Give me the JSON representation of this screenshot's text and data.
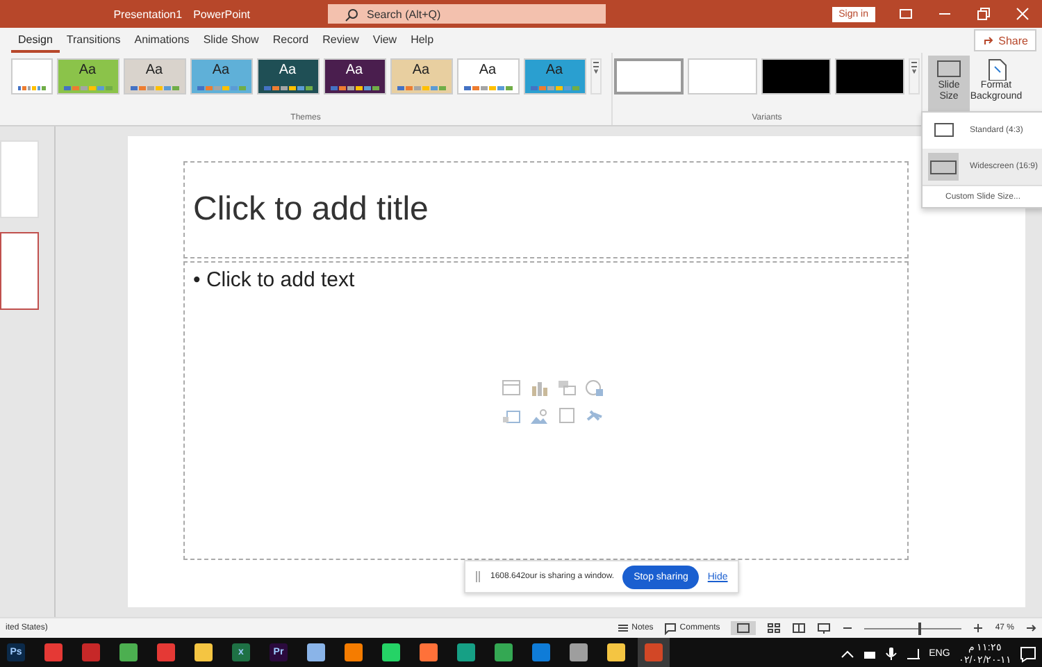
{
  "title_bar": {
    "file_name": "Presentation1",
    "app_name": "PowerPoint",
    "search": {
      "placeholder": "Search (Alt+Q)"
    },
    "sign_in": "Sign in"
  },
  "tabs": [
    {
      "label": "Design",
      "selected": true
    },
    {
      "label": "Transitions",
      "selected": false
    },
    {
      "label": "Animations",
      "selected": false
    },
    {
      "label": "Slide Show",
      "selected": false
    },
    {
      "label": "Record",
      "selected": false
    },
    {
      "label": "Review",
      "selected": false
    },
    {
      "label": "View",
      "selected": false
    },
    {
      "label": "Help",
      "selected": false
    }
  ],
  "share": "Share",
  "themes": {
    "label": "Themes",
    "items": [
      {
        "color": "#ffffff",
        "selected": false
      },
      {
        "label": "Aa",
        "color": "#8bc34a",
        "selected": false
      },
      {
        "label": "Aa",
        "color": "#d9d3cc",
        "selected": false
      },
      {
        "label": "Aa",
        "color": "#5fb0d8",
        "selected": false
      },
      {
        "label": "Aa",
        "color": "#1f4f55",
        "selected": false
      },
      {
        "label": "Aa",
        "color": "#4a1e4e",
        "selected": false
      },
      {
        "label": "Aa",
        "color": "#e8cfa0",
        "selected": false
      },
      {
        "label": "Aa",
        "color": "#ffffff",
        "selected": false
      },
      {
        "label": "Aa",
        "color": "#2a9fd0",
        "selected": false
      }
    ]
  },
  "variants": {
    "label": "Variants",
    "items": [
      {
        "color": "#ffffff",
        "selected": true
      },
      {
        "color": "#ffffff",
        "selected": false
      },
      {
        "color": "#000000",
        "selected": false
      },
      {
        "color": "#000000",
        "selected": false
      }
    ]
  },
  "slide_size": {
    "label": "Slide Size",
    "selected": true
  },
  "format_background": {
    "label": "Format Background"
  },
  "slide_size_menu": [
    {
      "label": "Standard (4:3)",
      "kind": "standard",
      "selected": false
    },
    {
      "label": "Widescreen (16:9)",
      "kind": "wide",
      "selected": true
    },
    {
      "label": "Custom Slide Size...",
      "kind": "custom",
      "selected": false
    }
  ],
  "thumbnails": [
    {
      "selected": false
    },
    {
      "selected": true
    }
  ],
  "slide": {
    "title_placeholder": "Click to add title",
    "bullet": "•",
    "text_placeholder": "Click to add text"
  },
  "sharing_bar": {
    "message": "1608.642our is sharing a window.",
    "stop": "Stop sharing",
    "hide": "Hide"
  },
  "status_bar": {
    "language": "ited States)",
    "notes": "Notes",
    "comments": "Comments",
    "zoom": {
      "reading": "47 %",
      "level": 0.55
    }
  },
  "taskbar": {
    "apps": [
      {
        "label": "Ps",
        "color": "#0b2a4a",
        "selected": false
      },
      {
        "color": "#e53935",
        "selected": false
      },
      {
        "color": "#c62828",
        "selected": false
      },
      {
        "color": "#4caf50",
        "selected": false
      },
      {
        "color": "#e53935",
        "selected": false
      },
      {
        "color": "#f4c542",
        "selected": false
      },
      {
        "label": "x",
        "color": "#1e7145",
        "selected": false
      },
      {
        "label": "Pr",
        "color": "#2b0a3d",
        "selected": false
      },
      {
        "color": "#8ab4e8",
        "selected": false
      },
      {
        "color": "#f57c00",
        "selected": false
      },
      {
        "color": "#25d366",
        "selected": false
      },
      {
        "color": "#ff7139",
        "selected": false
      },
      {
        "color": "#16a085",
        "selected": false
      },
      {
        "color": "#34a853",
        "selected": false
      },
      {
        "color": "#0f7cd8",
        "selected": false
      },
      {
        "color": "#9e9e9e",
        "selected": false
      },
      {
        "color": "#f4c542",
        "selected": false
      },
      {
        "color": "#d24726",
        "selected": true
      }
    ],
    "language": "ENG",
    "time": "١١:٢٥ م",
    "date": "١١-٠٢/٠٢/٢٠"
  }
}
